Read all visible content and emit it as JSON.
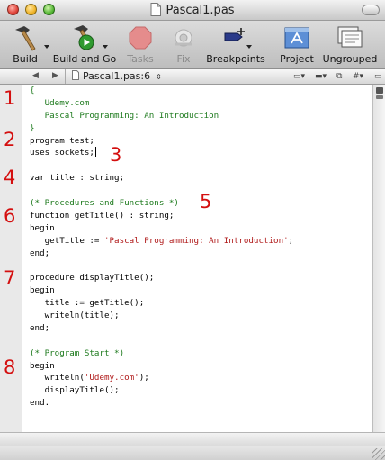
{
  "window": {
    "title": "Pascal1.pas"
  },
  "toolbar": {
    "items": [
      {
        "label": "Build",
        "icon": "hammer-icon",
        "enabled": true,
        "has_menu": true
      },
      {
        "label": "Build and Go",
        "icon": "hammer-play-icon",
        "enabled": true,
        "has_menu": true
      },
      {
        "label": "Tasks",
        "icon": "stop-sign-icon",
        "enabled": false,
        "has_menu": false
      },
      {
        "label": "Fix",
        "icon": "bandage-icon",
        "enabled": false,
        "has_menu": false
      },
      {
        "label": "Breakpoints",
        "icon": "breakpoint-icon",
        "enabled": true,
        "has_menu": true
      },
      {
        "label": "Project",
        "icon": "project-icon",
        "enabled": true,
        "has_menu": false
      },
      {
        "label": "Ungrouped",
        "icon": "ungrouped-icon",
        "enabled": true,
        "has_menu": false
      }
    ]
  },
  "navbar": {
    "file_label": "Pascal1.pas:6"
  },
  "code": {
    "lines": [
      [
        {
          "t": "{",
          "c": "cm"
        }
      ],
      [
        {
          "t": "   Udemy.com",
          "c": "cm"
        }
      ],
      [
        {
          "t": "   Pascal Programming: An Introduction",
          "c": "cm"
        }
      ],
      [
        {
          "t": "}",
          "c": "cm"
        }
      ],
      [
        {
          "t": "program test;",
          "c": "kw"
        }
      ],
      [
        {
          "t": "uses sockets;",
          "c": "kw"
        }
      ],
      [
        {
          "t": "",
          "c": "kw"
        }
      ],
      [
        {
          "t": "var title : string;",
          "c": "kw"
        }
      ],
      [
        {
          "t": "",
          "c": "kw"
        }
      ],
      [
        {
          "t": "(* Procedures and Functions *)",
          "c": "cm"
        }
      ],
      [
        {
          "t": "function getTitle() : string;",
          "c": "kw"
        }
      ],
      [
        {
          "t": "begin",
          "c": "kw"
        }
      ],
      [
        {
          "t": "   getTitle := ",
          "c": "kw"
        },
        {
          "t": "'Pascal Programming: An Introduction'",
          "c": "st"
        },
        {
          "t": ";",
          "c": "kw"
        }
      ],
      [
        {
          "t": "end;",
          "c": "kw"
        }
      ],
      [
        {
          "t": "",
          "c": "kw"
        }
      ],
      [
        {
          "t": "procedure displayTitle();",
          "c": "kw"
        }
      ],
      [
        {
          "t": "begin",
          "c": "kw"
        }
      ],
      [
        {
          "t": "   title := getTitle();",
          "c": "kw"
        }
      ],
      [
        {
          "t": "   writeln(title);",
          "c": "kw"
        }
      ],
      [
        {
          "t": "end;",
          "c": "kw"
        }
      ],
      [
        {
          "t": "",
          "c": "kw"
        }
      ],
      [
        {
          "t": "(* Program Start *)",
          "c": "cm"
        }
      ],
      [
        {
          "t": "begin",
          "c": "kw"
        }
      ],
      [
        {
          "t": "   writeln(",
          "c": "kw"
        },
        {
          "t": "'Udemy.com'",
          "c": "st"
        },
        {
          "t": ");",
          "c": "kw"
        }
      ],
      [
        {
          "t": "   displayTitle();",
          "c": "kw"
        }
      ],
      [
        {
          "t": "end.",
          "c": "kw"
        }
      ]
    ],
    "caret_line": 5,
    "colors": {
      "comment": "#1d7a1d",
      "string": "#b01a1a",
      "keyword": "#000000"
    }
  },
  "annotations": {
    "color": "#d40f0f",
    "labels": [
      "1",
      "2",
      "3",
      "4",
      "5",
      "6",
      "7",
      "8"
    ]
  }
}
